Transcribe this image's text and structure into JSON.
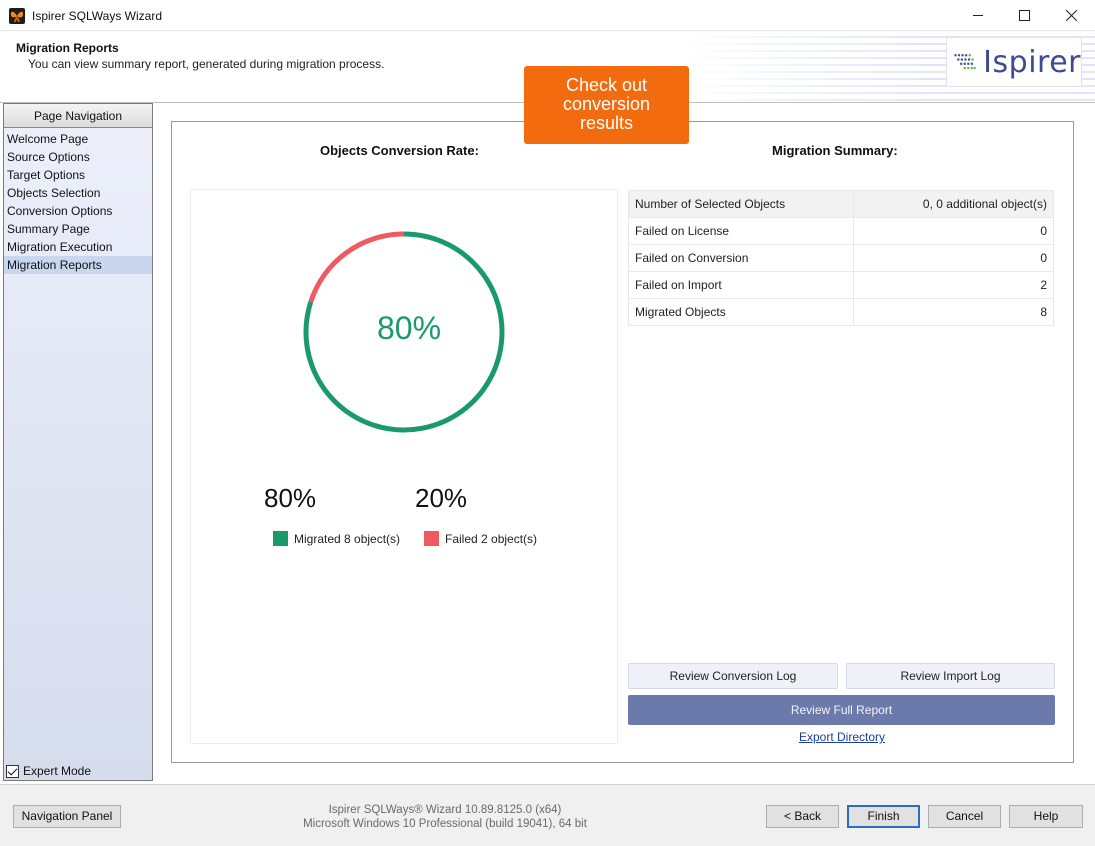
{
  "window": {
    "title": "Ispirer SQLWays Wizard",
    "minimize_glyph": "minimize-icon",
    "maximize_glyph": "maximize-icon",
    "close_glyph": "close-icon"
  },
  "header": {
    "title": "Migration Reports",
    "subtitle": "You can view summary report, generated during migration process.",
    "logo_text": "Ispirer"
  },
  "callout": {
    "lines": [
      "Check out",
      "conversion",
      "results"
    ]
  },
  "nav": {
    "heading": "Page Navigation",
    "items": [
      {
        "label": "Welcome Page"
      },
      {
        "label": "Source Options"
      },
      {
        "label": "Target Options"
      },
      {
        "label": "Objects Selection"
      },
      {
        "label": "Conversion Options"
      },
      {
        "label": "Summary Page"
      },
      {
        "label": "Migration Execution"
      },
      {
        "label": "Migration Reports"
      }
    ],
    "active_index": 7,
    "expert_mode_label": "Expert Mode",
    "expert_mode_checked": true
  },
  "conversion": {
    "title": "Objects Conversion Rate:",
    "center_label": "80%",
    "migrated_pct": "80%",
    "failed_pct": "20%",
    "migrated_legend": "Migrated 8 object(s)",
    "failed_legend": "Failed 2 object(s)",
    "migrated_fraction": 0.8,
    "failed_fraction": 0.2,
    "colors": {
      "migrated": "#1a9a6b",
      "failed": "#ee5a5f"
    }
  },
  "summary": {
    "title": "Migration Summary:",
    "rows": [
      {
        "label": "Number of Selected Objects",
        "value": "0, 0 additional object(s)"
      },
      {
        "label": "Failed on License",
        "value": "0"
      },
      {
        "label": "Failed on Conversion",
        "value": "0"
      },
      {
        "label": "Failed on Import",
        "value": "2"
      },
      {
        "label": "Migrated Objects",
        "value": "8"
      }
    ]
  },
  "actions": {
    "review_conversion_log": "Review Conversion Log",
    "review_import_log": "Review Import Log",
    "review_full_report": "Review Full Report",
    "export_directory": "Export Directory"
  },
  "footer": {
    "navigation_panel": "Navigation Panel",
    "version_line1": "Ispirer SQLWays® Wizard 10.89.8125.0 (x64)",
    "version_line2": "Microsoft Windows 10 Professional (build 19041), 64 bit",
    "back": "< Back",
    "finish": "Finish",
    "cancel": "Cancel",
    "help": "Help"
  }
}
